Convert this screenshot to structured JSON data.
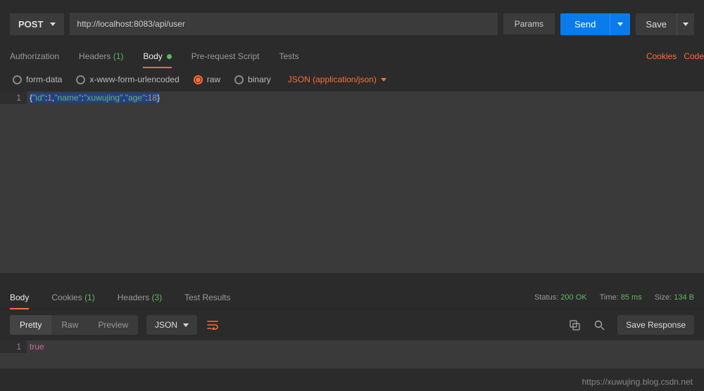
{
  "request": {
    "method": "POST",
    "url": "http://localhost:8083/api/user",
    "paramsLabel": "Params",
    "sendLabel": "Send",
    "saveLabel": "Save"
  },
  "requestTabs": {
    "authorization": "Authorization",
    "headers": "Headers",
    "headersCount": "(1)",
    "body": "Body",
    "preRequest": "Pre-request Script",
    "tests": "Tests"
  },
  "rightLinks": {
    "cookies": "Cookies",
    "code": "Code"
  },
  "bodyTypes": {
    "formData": "form-data",
    "urlencoded": "x-www-form-urlencoded",
    "raw": "raw",
    "binary": "binary",
    "contentType": "JSON (application/json)"
  },
  "requestBody": {
    "lineNumber": "1",
    "raw": "{\"id\":1,\"name\":\"xuwujing\",\"age\":18}"
  },
  "responseTabs": {
    "body": "Body",
    "cookies": "Cookies",
    "cookiesCount": "(1)",
    "headers": "Headers",
    "headersCount": "(3)",
    "testResults": "Test Results"
  },
  "responseStatus": {
    "statusLabel": "Status:",
    "statusValue": "200 OK",
    "timeLabel": "Time:",
    "timeValue": "85 ms",
    "sizeLabel": "Size:",
    "sizeValue": "134 B"
  },
  "viewBar": {
    "pretty": "Pretty",
    "raw": "Raw",
    "preview": "Preview",
    "jsonLabel": "JSON",
    "saveResponse": "Save Response"
  },
  "responseBody": {
    "lineNumber": "1",
    "value": "true"
  },
  "watermark": "https://xuwujing.blog.csdn.net"
}
